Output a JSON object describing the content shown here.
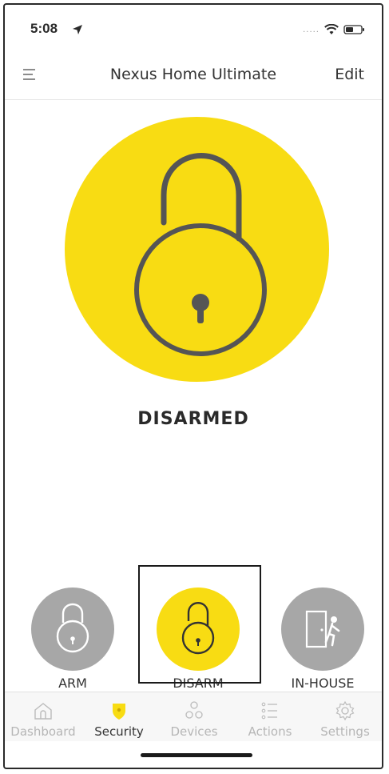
{
  "status_bar": {
    "time": "5:08",
    "signal": "....."
  },
  "nav": {
    "title": "Nexus Home Ultimate",
    "edit_label": "Edit"
  },
  "security": {
    "status": "DISARMED",
    "status_color": "#f8dc13"
  },
  "modes": [
    {
      "label": "ARM",
      "icon": "locked-padlock-icon",
      "selected": false
    },
    {
      "label": "DISARM",
      "icon": "unlocked-padlock-icon",
      "selected": true
    },
    {
      "label": "IN-HOUSE",
      "icon": "person-door-icon",
      "selected": false
    }
  ],
  "tabs": [
    {
      "label": "Dashboard",
      "icon": "home-icon",
      "active": false
    },
    {
      "label": "Security",
      "icon": "shield-icon",
      "active": true
    },
    {
      "label": "Devices",
      "icon": "devices-icon",
      "active": false
    },
    {
      "label": "Actions",
      "icon": "list-icon",
      "active": false
    },
    {
      "label": "Settings",
      "icon": "gear-icon",
      "active": false
    }
  ],
  "colors": {
    "accent_yellow": "#f8dc13",
    "inactive_gray": "#a7a7a7",
    "text_dark": "#2a2a2a"
  }
}
